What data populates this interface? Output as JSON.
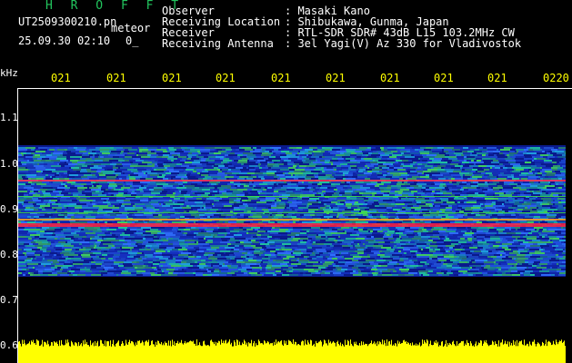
{
  "app": {
    "title": "H R O F F T",
    "filename": "UT2509300210.pn",
    "filename_suffix": "meteor",
    "datetime": "25.09.30 02:10",
    "marker": "0_"
  },
  "info": {
    "labels": [
      "Observer",
      "Receiving Location",
      "Receiver",
      "Receiving Antenna"
    ],
    "values": [
      ": Masaki Kano",
      ": Shibukawa, Gunma, Japan",
      ": RTL-SDR SDR# 43dB L15 103.2MHz CW",
      ": 3el Yagi(V) Az 330 for Vladivostok"
    ]
  },
  "axes": {
    "y_unit": "kHz",
    "y_ticks": [
      "1.1",
      "1.0",
      "0.9",
      "0.8",
      "0.7",
      "0.6"
    ],
    "time_ticks": [
      "021",
      "021",
      "021",
      "021",
      "021",
      "021",
      "021",
      "021",
      "021",
      "0220"
    ]
  },
  "colors": {
    "background": "#000000",
    "title": "#22c55e",
    "tick_labels": "#ffff00",
    "spectrum_base": "#0a1a8c",
    "strong_signal": "#ff2040",
    "noise_bars": "#ffff00"
  }
}
